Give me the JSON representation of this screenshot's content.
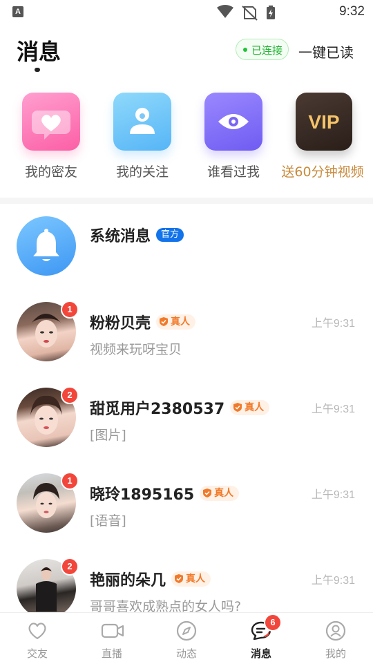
{
  "status_bar": {
    "app_glyph": "A",
    "time": "9:32"
  },
  "header": {
    "title": "消息",
    "connection_status": "已连接",
    "mark_all_read": "一键已读"
  },
  "quick_entries": [
    {
      "label": "我的密友",
      "icon": "heart-chat-icon"
    },
    {
      "label": "我的关注",
      "icon": "person-icon"
    },
    {
      "label": "谁看过我",
      "icon": "eye-icon"
    },
    {
      "label": "送60分钟视频",
      "icon": "vip-icon",
      "icon_text": "VIP",
      "highlight_color": "#c98a3c"
    }
  ],
  "system_message": {
    "title": "系统消息",
    "tag": "官方"
  },
  "messages": [
    {
      "name": "粉粉贝壳",
      "tag": "真人",
      "time": "上午9:31",
      "preview": "视频来玩呀宝贝",
      "unread": "1"
    },
    {
      "name": "甜觅用户2380537",
      "tag": "真人",
      "time": "上午9:31",
      "preview": "[图片]",
      "unread": "2"
    },
    {
      "name": "晓玲1895165",
      "tag": "真人",
      "time": "上午9:31",
      "preview": "[语音]",
      "unread": "1"
    },
    {
      "name": "艳丽的朵几",
      "tag": "真人",
      "time": "上午9:31",
      "preview": "哥哥喜欢成熟点的女人吗?",
      "unread": "2"
    }
  ],
  "bottom_nav": {
    "items": [
      {
        "label": "交友",
        "icon": "heart-icon"
      },
      {
        "label": "直播",
        "icon": "video-camera-icon"
      },
      {
        "label": "动态",
        "icon": "compass-icon"
      },
      {
        "label": "消息",
        "icon": "chat-icon",
        "active": true
      },
      {
        "label": "我的",
        "icon": "user-icon"
      }
    ],
    "message_badge": "6"
  },
  "colors": {
    "accent_red": "#f2463b",
    "official_blue": "#1273ea",
    "real_orange": "#f07a2a",
    "connected_green": "#22b533"
  }
}
